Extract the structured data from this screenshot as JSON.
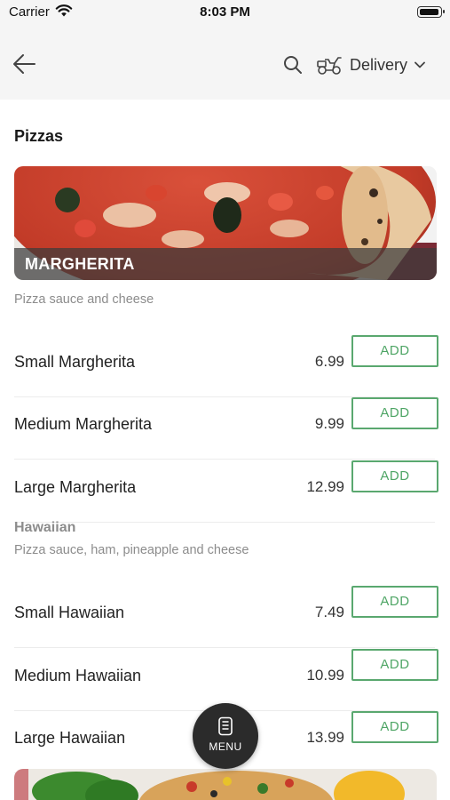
{
  "status_bar": {
    "carrier": "Carrier",
    "time": "8:03 PM"
  },
  "nav": {
    "delivery_label": "Delivery"
  },
  "section": {
    "title": "Pizzas"
  },
  "margherita": {
    "banner": "MARGHERITA",
    "description": "Pizza sauce and cheese",
    "items": [
      {
        "name": "Small Margherita",
        "price": "6.99",
        "action": "ADD"
      },
      {
        "name": "Medium Margherita",
        "price": "9.99",
        "action": "ADD"
      },
      {
        "name": "Large Margherita",
        "price": "12.99",
        "action": "ADD"
      }
    ]
  },
  "hawaiian": {
    "heading": "Hawaiian",
    "description": "Pizza sauce, ham, pineapple and cheese",
    "items": [
      {
        "name": "Small Hawaiian",
        "price": "7.49",
        "action": "ADD"
      },
      {
        "name": "Medium Hawaiian",
        "price": "10.99",
        "action": "ADD"
      },
      {
        "name": "Large Hawaiian",
        "price": "13.99",
        "action": "ADD"
      }
    ]
  },
  "fab": {
    "label": "MENU"
  },
  "icons": {
    "back": "arrow-left-icon",
    "search": "search-icon",
    "delivery": "scooter-icon",
    "dropdown": "chevron-down-icon",
    "menu": "menu-card-icon"
  },
  "colors": {
    "accent": "#4ea565",
    "fab": "#2b2b2b",
    "header_bg": "#f5f5f5"
  }
}
